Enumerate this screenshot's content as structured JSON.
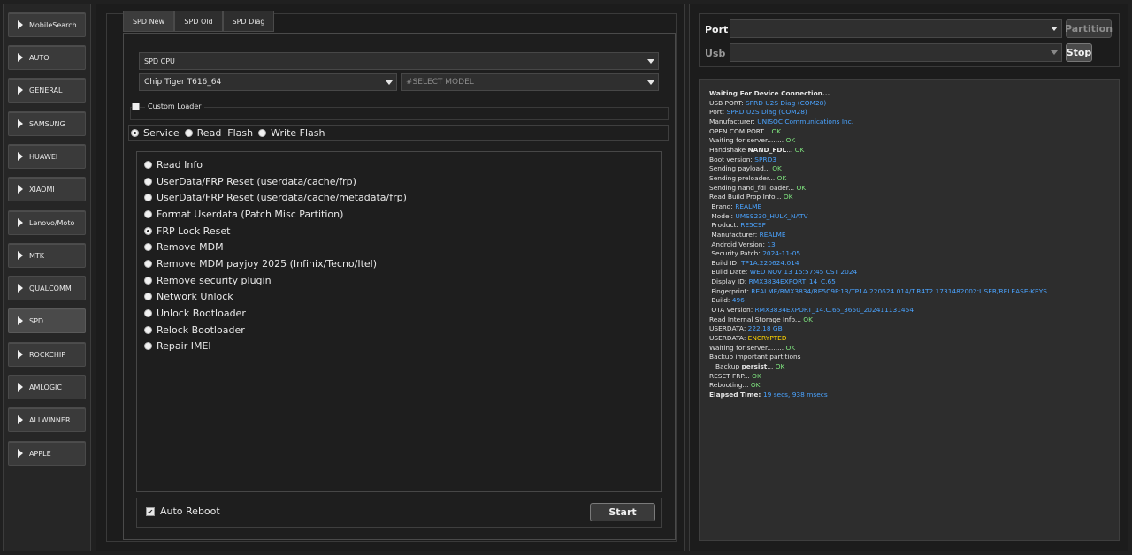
{
  "sidebar": {
    "items": [
      {
        "label": "MobileSearch"
      },
      {
        "label": "AUTO"
      },
      {
        "label": "GENERAL"
      },
      {
        "label": "SAMSUNG"
      },
      {
        "label": "HUAWEI"
      },
      {
        "label": "XIAOMI"
      },
      {
        "label": "Lenovo/Moto"
      },
      {
        "label": "MTK"
      },
      {
        "label": "QUALCOMM"
      },
      {
        "label": "SPD",
        "active": true
      },
      {
        "label": "ROCKCHIP"
      },
      {
        "label": "AMLOGIC"
      },
      {
        "label": "ALLWINNER"
      },
      {
        "label": "APPLE"
      }
    ]
  },
  "tabs": [
    {
      "label": "SPD New",
      "active": true
    },
    {
      "label": "SPD Old"
    },
    {
      "label": "SPD Diag"
    }
  ],
  "spd": {
    "cpu_select": "SPD CPU",
    "chip_select": "Chip Tiger T616_64",
    "model_placeholder": "#SELECT MODEL",
    "custom_loader_label": "Custom Loader",
    "modes": [
      {
        "label": "Service",
        "selected": true
      },
      {
        "label": "Read  Flash",
        "selected": false
      },
      {
        "label": "Write Flash",
        "selected": false
      }
    ],
    "operations": [
      {
        "label": "Read Info",
        "selected": false
      },
      {
        "label": "UserData/FRP Reset (userdata/cache/frp)",
        "selected": false
      },
      {
        "label": "UserData/FRP Reset (userdata/cache/metadata/frp)",
        "selected": false
      },
      {
        "label": "Format Userdata (Patch Misc Partition)",
        "selected": false
      },
      {
        "label": "FRP Lock Reset",
        "selected": true
      },
      {
        "label": "Remove MDM",
        "selected": false
      },
      {
        "label": "Remove MDM payjoy 2025 (Infinix/Tecno/Itel)",
        "selected": false
      },
      {
        "label": "Remove security plugin",
        "selected": false
      },
      {
        "label": "Network Unlock",
        "selected": false
      },
      {
        "label": "Unlock Bootloader",
        "selected": false
      },
      {
        "label": "Relock Bootloader",
        "selected": false
      },
      {
        "label": "Repair IMEI",
        "selected": false
      }
    ],
    "auto_reboot_label": "Auto Reboot",
    "auto_reboot_checked": true,
    "start_label": "Start"
  },
  "connection": {
    "port_label": "Port",
    "usb_label": "Usb",
    "partition_label": "Partition",
    "stop_label": "Stop"
  },
  "log": [
    [
      {
        "t": "Waiting For Device Connection...",
        "s": "b"
      }
    ],
    [
      {
        "t": "USB PORT: "
      },
      {
        "t": "SPRD U2S Diag (COM28)",
        "s": "blue"
      }
    ],
    [
      {
        "t": "Port: "
      },
      {
        "t": "SPRD U2S Diag (COM28)",
        "s": "blue"
      }
    ],
    [
      {
        "t": "Manufacturer: "
      },
      {
        "t": "UNISOC Communications Inc.",
        "s": "blue"
      }
    ],
    [
      {
        "t": "OPEN COM PORT... "
      },
      {
        "t": "OK",
        "s": "green"
      }
    ],
    [
      {
        "t": "Waiting for server........ "
      },
      {
        "t": "OK",
        "s": "green"
      }
    ],
    [
      {
        "t": "Handshake "
      },
      {
        "t": "NAND_FDL",
        "s": "b"
      },
      {
        "t": "... "
      },
      {
        "t": "OK",
        "s": "green"
      }
    ],
    [
      {
        "t": "Boot version: "
      },
      {
        "t": "SPRD3",
        "s": "blue"
      }
    ],
    [
      {
        "t": "Sending payload... "
      },
      {
        "t": "OK",
        "s": "green"
      }
    ],
    [
      {
        "t": "Sending preloader... "
      },
      {
        "t": "OK",
        "s": "green"
      }
    ],
    [
      {
        "t": "Sending nand_fdl loader... "
      },
      {
        "t": "OK",
        "s": "green"
      }
    ],
    [
      {
        "t": "Read Build Prop Info... "
      },
      {
        "t": "OK",
        "s": "green"
      }
    ],
    [
      {
        "t": " Brand: "
      },
      {
        "t": "REALME",
        "s": "blue"
      }
    ],
    [
      {
        "t": " Model: "
      },
      {
        "t": "UMS9230_HULK_NATV",
        "s": "blue"
      }
    ],
    [
      {
        "t": " Product: "
      },
      {
        "t": "RE5C9F",
        "s": "blue"
      }
    ],
    [
      {
        "t": " Manufacturer: "
      },
      {
        "t": "REALME",
        "s": "blue"
      }
    ],
    [
      {
        "t": " Android Version: "
      },
      {
        "t": "13",
        "s": "blue"
      }
    ],
    [
      {
        "t": " Security Patch: "
      },
      {
        "t": "2024-11-05",
        "s": "blue"
      }
    ],
    [
      {
        "t": " Build ID: "
      },
      {
        "t": "TP1A.220624.014",
        "s": "blue"
      }
    ],
    [
      {
        "t": " Build Date: "
      },
      {
        "t": "WED NOV 13 15:57:45 CST 2024",
        "s": "blue"
      }
    ],
    [
      {
        "t": " Display ID: "
      },
      {
        "t": "RMX3834EXPORT_14_C.65",
        "s": "blue"
      }
    ],
    [
      {
        "t": " Fingerprint: "
      },
      {
        "t": "REALME/RMX3834/RE5C9F:13/TP1A.220624.014/T.R4T2.1731482002:USER/RELEASE-KEYS",
        "s": "blue"
      }
    ],
    [
      {
        "t": " Build: "
      },
      {
        "t": "496",
        "s": "blue"
      }
    ],
    [
      {
        "t": " OTA Version: "
      },
      {
        "t": "RMX3834EXPORT_14.C.65_3650_202411131454",
        "s": "blue"
      }
    ],
    [
      {
        "t": "Read Internal Storage Info... "
      },
      {
        "t": "OK",
        "s": "green"
      }
    ],
    [
      {
        "t": "USERDATA: "
      },
      {
        "t": "222.18 GB",
        "s": "blue"
      }
    ],
    [
      {
        "t": "USERDATA: "
      },
      {
        "t": "ENCRYPTED",
        "s": "yellow"
      }
    ],
    [
      {
        "t": "Waiting for server........ "
      },
      {
        "t": "OK",
        "s": "green"
      }
    ],
    [
      {
        "t": "Backup important partitions"
      }
    ],
    [
      {
        "t": "   Backup "
      },
      {
        "t": "persist",
        "s": "b"
      },
      {
        "t": "... "
      },
      {
        "t": "OK",
        "s": "green"
      }
    ],
    [
      {
        "t": "RESET FRP... "
      },
      {
        "t": "OK",
        "s": "green"
      }
    ],
    [
      {
        "t": "Rebooting... "
      },
      {
        "t": "OK",
        "s": "green"
      }
    ],
    [
      {
        "t": "Elapsed Time: ",
        "s": "b"
      },
      {
        "t": "19 secs, 938 msecs",
        "s": "blue"
      }
    ]
  ]
}
